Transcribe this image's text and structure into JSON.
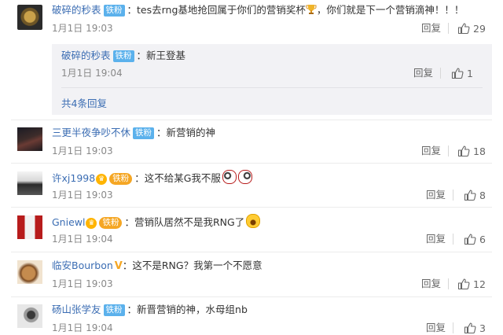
{
  "comments": [
    {
      "user": "破碎的秒表",
      "badge": "铁粉",
      "text": "：tes去rng基地抢回属于你们的营销奖杯",
      "text_suffix": "，你们就是下一个营销滴神！！！",
      "time": "1月1日 19:03",
      "reply_label": "回复",
      "likes": "29"
    },
    {
      "user": "三更半夜争吵不休",
      "badge": "铁粉",
      "text": "：新营销的神",
      "time": "1月1日 19:03",
      "reply_label": "回复",
      "likes": "18"
    },
    {
      "user": "许xj1998",
      "badge": "铁粉",
      "text": "：这不给某G我不服",
      "time": "1月1日 19:03",
      "reply_label": "回复",
      "likes": "8"
    },
    {
      "user": "Gniewl",
      "badge": "铁粉",
      "text": "：营销队居然不是我RNG了",
      "time": "1月1日 19:04",
      "reply_label": "回复",
      "likes": "6"
    },
    {
      "user": "临安Bourbon",
      "vmark": "V",
      "text": "：这不是RNG？我第一个不愿意",
      "time": "1月1日 19:03",
      "reply_label": "回复",
      "likes": "12"
    },
    {
      "user": "砀山张学友",
      "badge": "铁粉",
      "text": "：新晋营销的神，水母组nb",
      "time": "1月1日 19:04",
      "reply_label": "回复",
      "likes": "3"
    }
  ],
  "sub_reply": {
    "user": "破碎的秒表",
    "badge": "铁粉",
    "text": "：新王登基",
    "time": "1月1日 19:04",
    "reply_label": "回复",
    "likes": "1",
    "more_label": "共4条回复"
  },
  "icons": {
    "like": "thumbs-up-icon",
    "trophy": "trophy-emoji-icon",
    "emoji": "emoji-icon"
  },
  "colors": {
    "username": "#3b6db3",
    "badge": "#5bb1ec",
    "badge_round": "#f5a623",
    "subreply_bg": "#f2f2f5",
    "meta_text": "#888888"
  }
}
